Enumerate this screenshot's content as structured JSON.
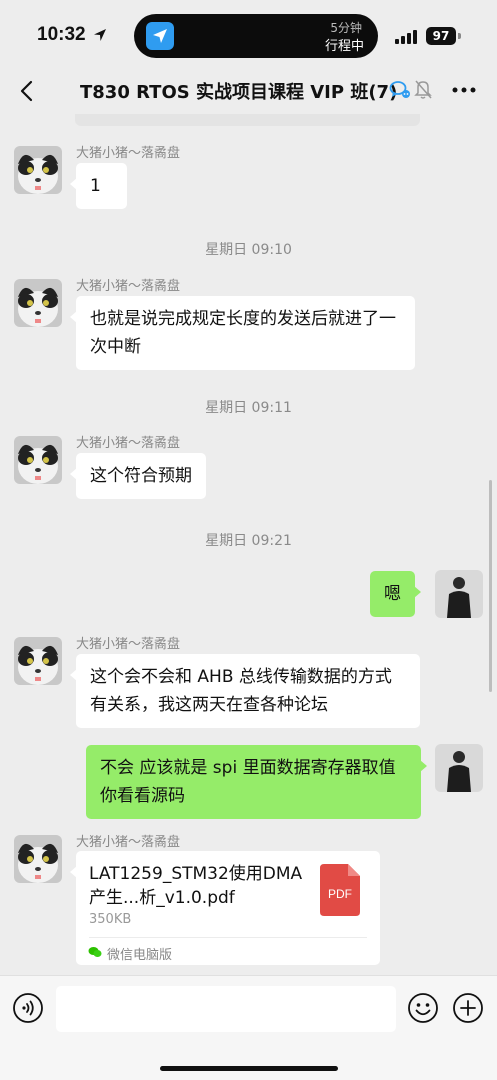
{
  "status_bar": {
    "time": "10:32",
    "trip_top": "5分钟",
    "trip_bottom": "行程中",
    "battery": "97"
  },
  "header": {
    "title": "T830 RTOS 实战项目课程 VIP 班(7)"
  },
  "messages": [
    {
      "type": "text",
      "direction": "in",
      "sender": "大猪小猪～落矞盘",
      "text": "1"
    },
    {
      "type": "time",
      "text": "星期日 09:10"
    },
    {
      "type": "text",
      "direction": "in",
      "sender": "大猪小猪～落矞盘",
      "text": "也就是说完成规定长度的发送后就进了一次中断"
    },
    {
      "type": "time",
      "text": "星期日 09:11"
    },
    {
      "type": "text",
      "direction": "in",
      "sender": "大猪小猪～落矞盘",
      "text": "这个符合预期"
    },
    {
      "type": "time",
      "text": "星期日 09:21"
    },
    {
      "type": "text",
      "direction": "out",
      "text": "嗯"
    },
    {
      "type": "text",
      "direction": "in",
      "sender": "大猪小猪～落矞盘",
      "text": "这个会不会和 AHB 总线传输数据的方式有关系，我这两天在查各种论坛"
    },
    {
      "type": "text",
      "direction": "out",
      "text": "不会 应该就是 spi 里面数据寄存器取值 你看看源码"
    },
    {
      "type": "file",
      "direction": "in",
      "sender": "大猪小猪～落矞盘",
      "file_name": "LAT1259_STM32使用DMA产生...析_v1.0.pdf",
      "file_size": "350KB",
      "file_type_label": "PDF",
      "source": "微信电脑版"
    }
  ],
  "input": {
    "value": ""
  },
  "colors": {
    "background": "#ededed",
    "outgoing_bubble": "#95ec69",
    "incoming_bubble": "#ffffff",
    "pdf_red": "#e14b45"
  }
}
